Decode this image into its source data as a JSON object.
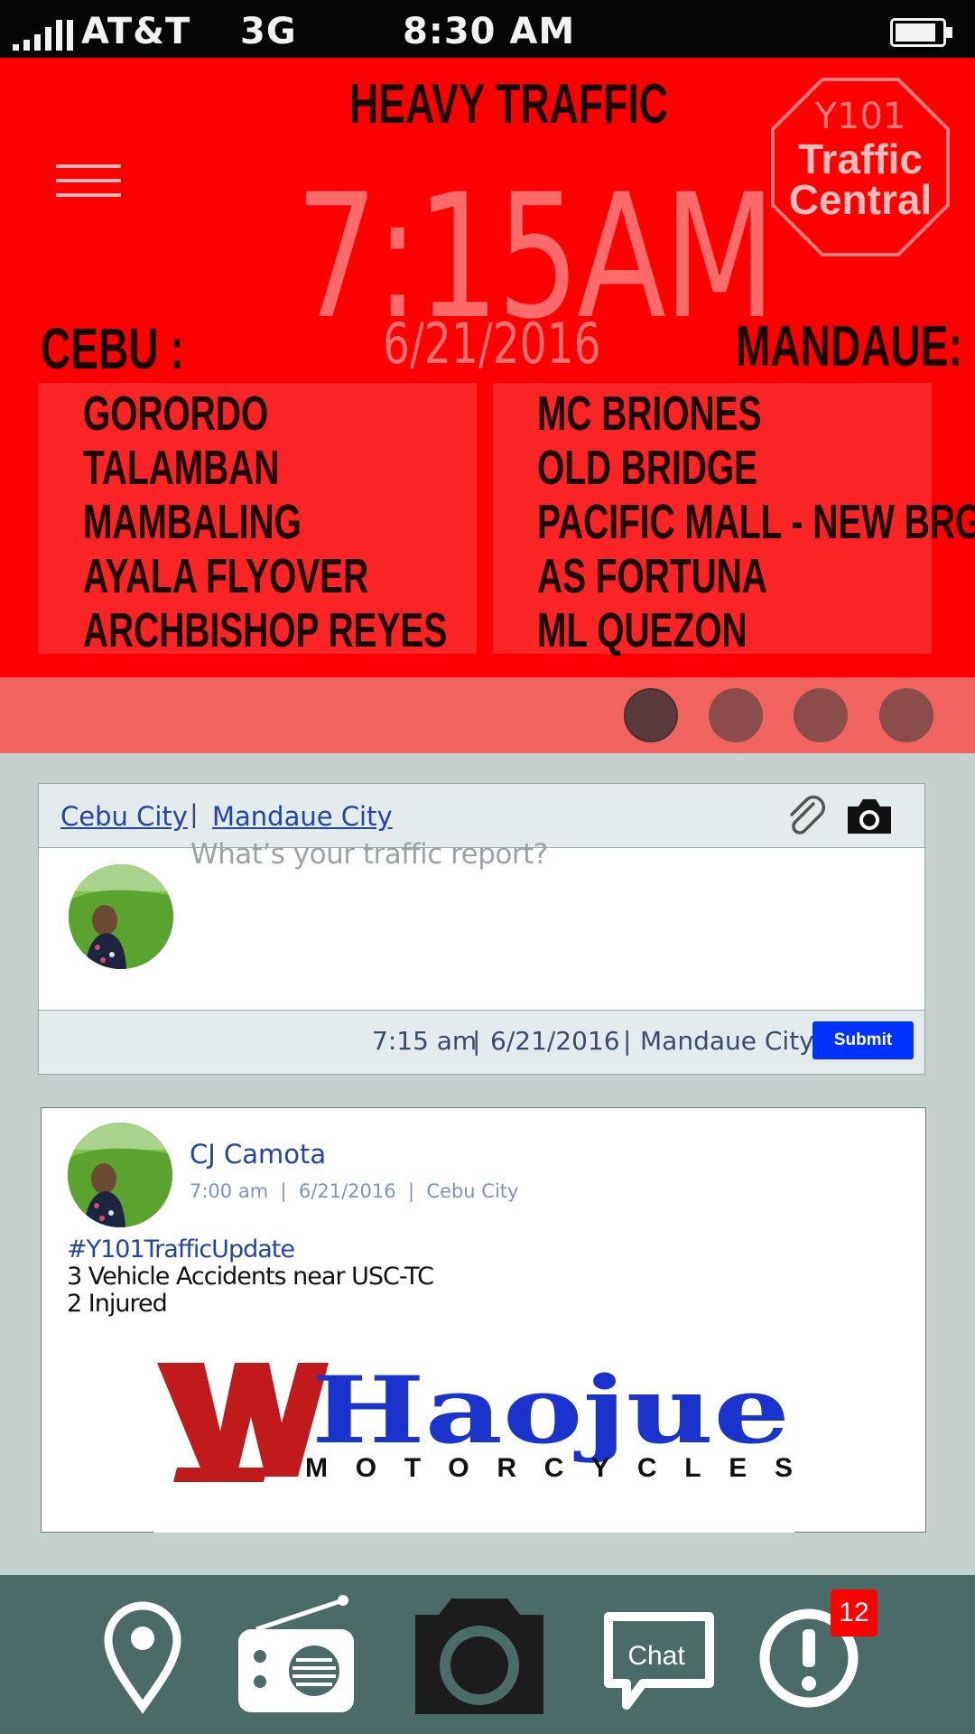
{
  "status_bar": {
    "carrier": "AT&T",
    "network": "3G",
    "time": "8:30 AM"
  },
  "traffic": {
    "status": "HEAVY TRAFFIC",
    "time": "7:15AM",
    "date": "6/21/2016",
    "logo": {
      "line1": "Y101",
      "line2": "Traffic",
      "line3": "Central"
    },
    "cebu": {
      "label": "CEBU :",
      "routes": [
        "GORORDO",
        "TALAMBAN",
        "MAMBALING",
        "AYALA FLYOVER",
        "ARCHBISHOP REYES"
      ]
    },
    "mandaue": {
      "label": "MANDAUE:",
      "routes": [
        "MC BRIONES",
        "OLD BRIDGE",
        "PACIFIC MALL - NEW BRG",
        "AS FORTUNA",
        "ML QUEZON"
      ]
    }
  },
  "pager": {
    "count": 4,
    "active_index": 0,
    "colors": {
      "active": "#5a3a3a",
      "inactive": "#8a4d4b"
    }
  },
  "compose": {
    "city_links": [
      "Cebu City",
      "Mandaue City"
    ],
    "separator": "|",
    "placeholder": "What’s your traffic report?",
    "footer": {
      "time": "7:15 am",
      "date": "6/21/2016",
      "city": "Mandaue City"
    },
    "submit_label": "Submit"
  },
  "post": {
    "author": "CJ Camota",
    "time": "7:00 am",
    "date": "6/21/2016",
    "city": "Cebu City",
    "meta": "7:00 am  |  6/21/2016  |  Cebu City",
    "hashtag": "#Y101TrafficUpdate",
    "lines": [
      "3 Vehicle Accidents near USC-TC",
      "2 Injured"
    ],
    "ad": {
      "brand": "Haojue",
      "tagline": "MOTORCYCLES"
    }
  },
  "bottom_nav": {
    "items": [
      "location-pin-icon",
      "radio-icon",
      "camera-icon",
      "chat-icon",
      "alert-icon"
    ],
    "chat_label": "Chat",
    "alert_badge": "12"
  },
  "colors": {
    "traffic_red": "#ff0000",
    "pager": "#f0635f",
    "nav": "#4b6b69",
    "submit": "#0033ff",
    "link": "#2244aa"
  }
}
